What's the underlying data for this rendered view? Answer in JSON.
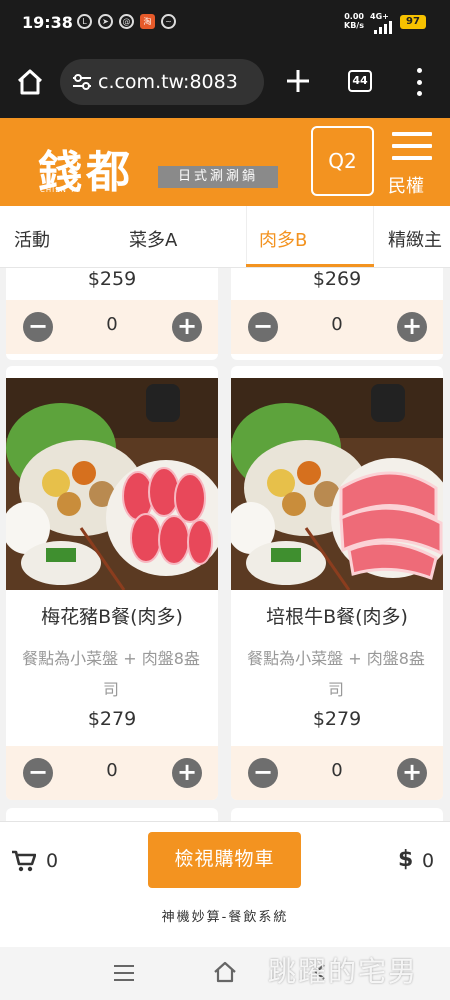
{
  "status_bar": {
    "time": "19:38",
    "network_speed": "0.00\nKB/s",
    "network_type": "4G+",
    "battery": "97"
  },
  "browser": {
    "url": "c.com.tw:8083",
    "tab_count": "44"
  },
  "header": {
    "logo_text": "錢都",
    "logo_latin": "CHIEN TU",
    "logo_tagline": "日式涮涮鍋",
    "table_label": "Q2",
    "user_name": "民權"
  },
  "categories": {
    "tabs": [
      "活動",
      "菜多A",
      "肉多B",
      "精緻主"
    ],
    "active": "肉多B"
  },
  "products_top": [
    {
      "price": "$259",
      "qty": "0"
    },
    {
      "price": "$269",
      "qty": "0"
    }
  ],
  "products": [
    {
      "name": "梅花豬B餐(肉多)",
      "desc": "餐點為小菜盤 + 肉盤8盎司",
      "price": "$279",
      "qty": "0"
    },
    {
      "name": "培根牛B餐(肉多)",
      "desc": "餐點為小菜盤 + 肉盤8盎司",
      "price": "$279",
      "qty": "0"
    }
  ],
  "cart": {
    "count": "0",
    "view_label": "檢視購物車",
    "currency_symbol": "$",
    "total": "0"
  },
  "footer": {
    "text": "神機妙算-餐飲系統"
  },
  "watermark": "跳躍的宅男",
  "colors": {
    "brand_orange": "#f39320",
    "qty_row_bg": "#fdf1e6",
    "qty_button": "#6e6e6e"
  }
}
